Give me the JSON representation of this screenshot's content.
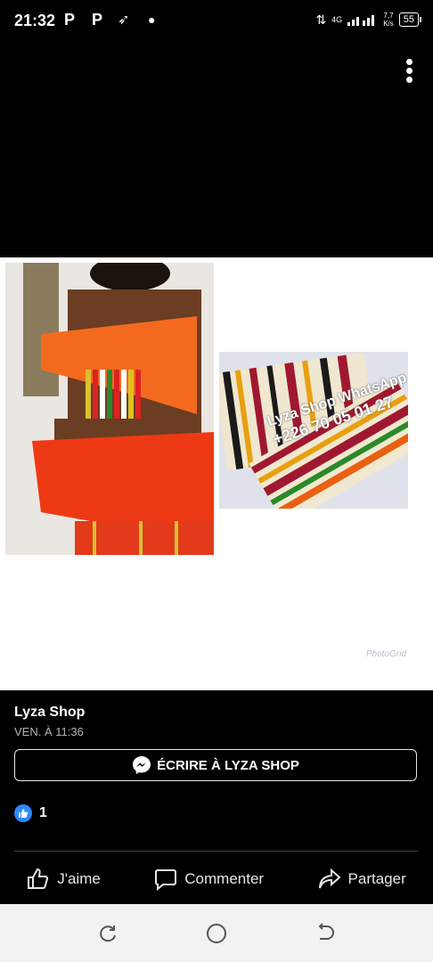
{
  "status_bar": {
    "time": "21:32",
    "notifications": [
      "P",
      "P"
    ],
    "network": "4G",
    "speed_value": "7,7",
    "speed_unit": "K/s",
    "battery": "55"
  },
  "photo": {
    "watermark_line1": "Lyza Shop WhatsApp",
    "watermark_line2": "+226 70 05 01 27",
    "photogrid_mark": "PhotoGrid"
  },
  "post": {
    "author": "Lyza Shop",
    "time": "VEN. À 11:36",
    "message_button": "ÉCRIRE À LYZA SHOP",
    "reaction_count": "1"
  },
  "actions": {
    "like": "J'aime",
    "comment": "Commenter",
    "share": "Partager"
  },
  "colors": {
    "background": "#000000",
    "like_blue": "#2d88ff",
    "nav_bar": "#f2f2f2"
  }
}
